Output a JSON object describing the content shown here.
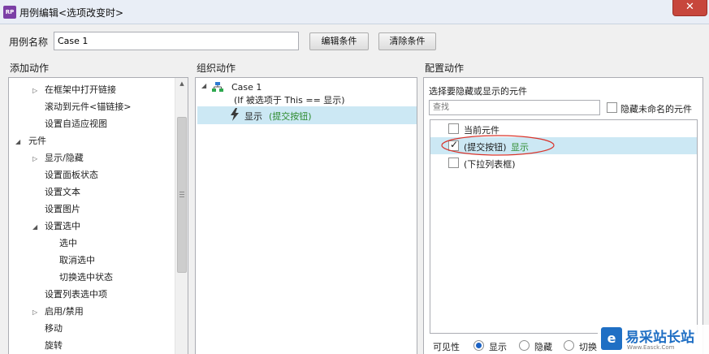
{
  "window": {
    "title": "用例编辑<选项改变时>",
    "app_icon_text": "RP",
    "close_glyph": "✕"
  },
  "case_name": {
    "label": "用例名称",
    "value": "Case 1"
  },
  "buttons": {
    "edit_condition": "编辑条件",
    "clear_condition": "清除条件"
  },
  "sections": {
    "add_action": "添加动作",
    "organize_action": "组织动作",
    "configure_action": "配置动作"
  },
  "add_action_tree": [
    {
      "label": "在框架中打开链接",
      "indent": 2,
      "arrow": "▷"
    },
    {
      "label": "滚动到元件<锚链接>",
      "indent": 2,
      "arrow": ""
    },
    {
      "label": "设置自适应视图",
      "indent": 2,
      "arrow": ""
    },
    {
      "label": "元件",
      "indent": 1,
      "arrow": "◢"
    },
    {
      "label": "显示/隐藏",
      "indent": 2,
      "arrow": "▷"
    },
    {
      "label": "设置面板状态",
      "indent": 2,
      "arrow": ""
    },
    {
      "label": "设置文本",
      "indent": 2,
      "arrow": ""
    },
    {
      "label": "设置图片",
      "indent": 2,
      "arrow": ""
    },
    {
      "label": "设置选中",
      "indent": 2,
      "arrow": "◢"
    },
    {
      "label": "选中",
      "indent": 3,
      "arrow": ""
    },
    {
      "label": "取消选中",
      "indent": 3,
      "arrow": ""
    },
    {
      "label": "切换选中状态",
      "indent": 3,
      "arrow": ""
    },
    {
      "label": "设置列表选中项",
      "indent": 2,
      "arrow": ""
    },
    {
      "label": "启用/禁用",
      "indent": 2,
      "arrow": "▷"
    },
    {
      "label": "移动",
      "indent": 2,
      "arrow": ""
    },
    {
      "label": "旋转",
      "indent": 2,
      "arrow": ""
    }
  ],
  "organize_tree": {
    "case_label": "Case 1",
    "condition": "(If 被选项于 This == 显示)",
    "action_verb": "显示",
    "action_target": "(提交按钮)"
  },
  "configure": {
    "prompt": "选择要隐藏或显示的元件",
    "search_placeholder": "查找",
    "hide_unnamed_label": "隐藏未命名的元件",
    "elements": [
      {
        "label": "当前元件",
        "checked": false,
        "status": ""
      },
      {
        "label": "(提交按钮)",
        "checked": true,
        "status": "显示"
      },
      {
        "label": "(下拉列表框)",
        "checked": false,
        "status": ""
      }
    ],
    "visibility": {
      "label": "可见性",
      "options": [
        {
          "label": "显示",
          "selected": true
        },
        {
          "label": "隐藏",
          "selected": false
        },
        {
          "label": "切换",
          "selected": false
        }
      ]
    }
  },
  "watermark": {
    "text": "易采站长站",
    "sub": "Www.Easck.Com"
  },
  "colors": {
    "selected_row": "#cce8f4",
    "status_green": "#2e8b2e",
    "annotation_red": "#d9342b",
    "checkmark": "#1a1a1a"
  }
}
